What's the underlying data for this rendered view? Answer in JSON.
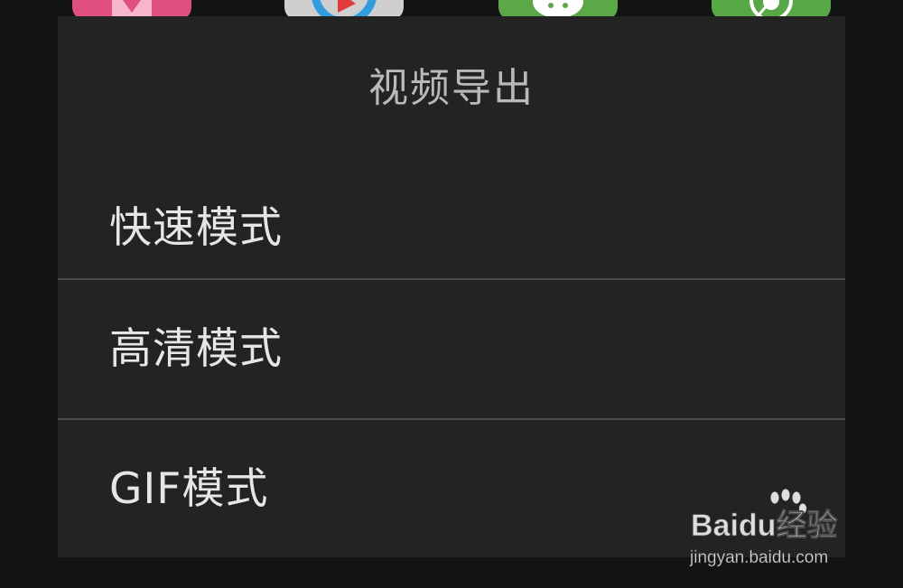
{
  "dialog": {
    "title": "视频导出",
    "options": [
      {
        "label": "快速模式"
      },
      {
        "label": "高清模式"
      },
      {
        "label": "GIF模式"
      }
    ]
  },
  "background_apps": [
    {
      "icon": "video-editor-app-icon",
      "color": "#e04f82"
    },
    {
      "icon": "video-player-app-icon",
      "color": "#cfcfcf"
    },
    {
      "icon": "wechat-app-icon",
      "color": "#5aa846"
    },
    {
      "icon": "green-app-icon",
      "color": "#56a845"
    }
  ],
  "watermark": {
    "logo_text": "Baidu经验",
    "url": "jingyan.baidu.com"
  },
  "colors": {
    "dialog_background": "#232323",
    "title_text": "#b9b9b9",
    "option_text": "#e6e6e6",
    "divider": "#4b4b4b",
    "screen_background": "#131313"
  }
}
